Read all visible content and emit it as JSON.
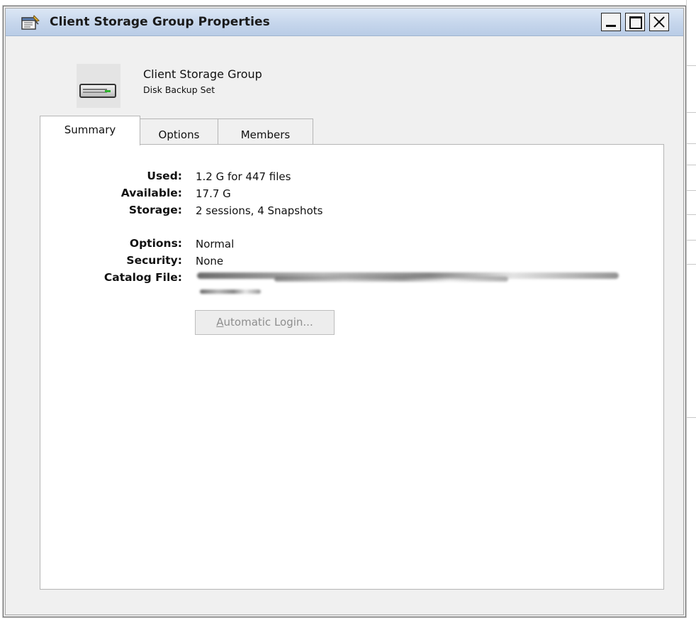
{
  "window": {
    "title": "Client Storage Group Properties",
    "icon": "properties-icon",
    "controls": {
      "minimize_icon": "minimize-icon",
      "maximize_icon": "maximize-icon",
      "close_icon": "close-icon"
    }
  },
  "header": {
    "icon": "disk-drive-icon",
    "title": "Client Storage Group",
    "subtitle": "Disk Backup Set"
  },
  "tabs": [
    {
      "label": "Summary",
      "selected": true
    },
    {
      "label": "Options",
      "selected": false
    },
    {
      "label": "Members",
      "selected": false
    }
  ],
  "summary": {
    "used_label": "Used:",
    "used_value": "1.2 G for 447 files",
    "available_label": "Available:",
    "available_value": "17.7 G",
    "storage_label": "Storage:",
    "storage_value": "2 sessions, 4 Snapshots",
    "options_label": "Options:",
    "options_value": "Normal",
    "security_label": "Security:",
    "security_value": "None",
    "catalog_label": "Catalog File:",
    "catalog_value_redacted": true,
    "login_button_label_first": "A",
    "login_button_label_rest": "utomatic Login...",
    "login_button_enabled": false
  },
  "colors": {
    "titlebar_top": "#dce7f5",
    "titlebar_bottom": "#b9cce6",
    "window_bg": "#f0f0f0",
    "panel_bg": "#ffffff",
    "disabled_text": "#8e8e8e",
    "drive_led": "#2db32d"
  }
}
